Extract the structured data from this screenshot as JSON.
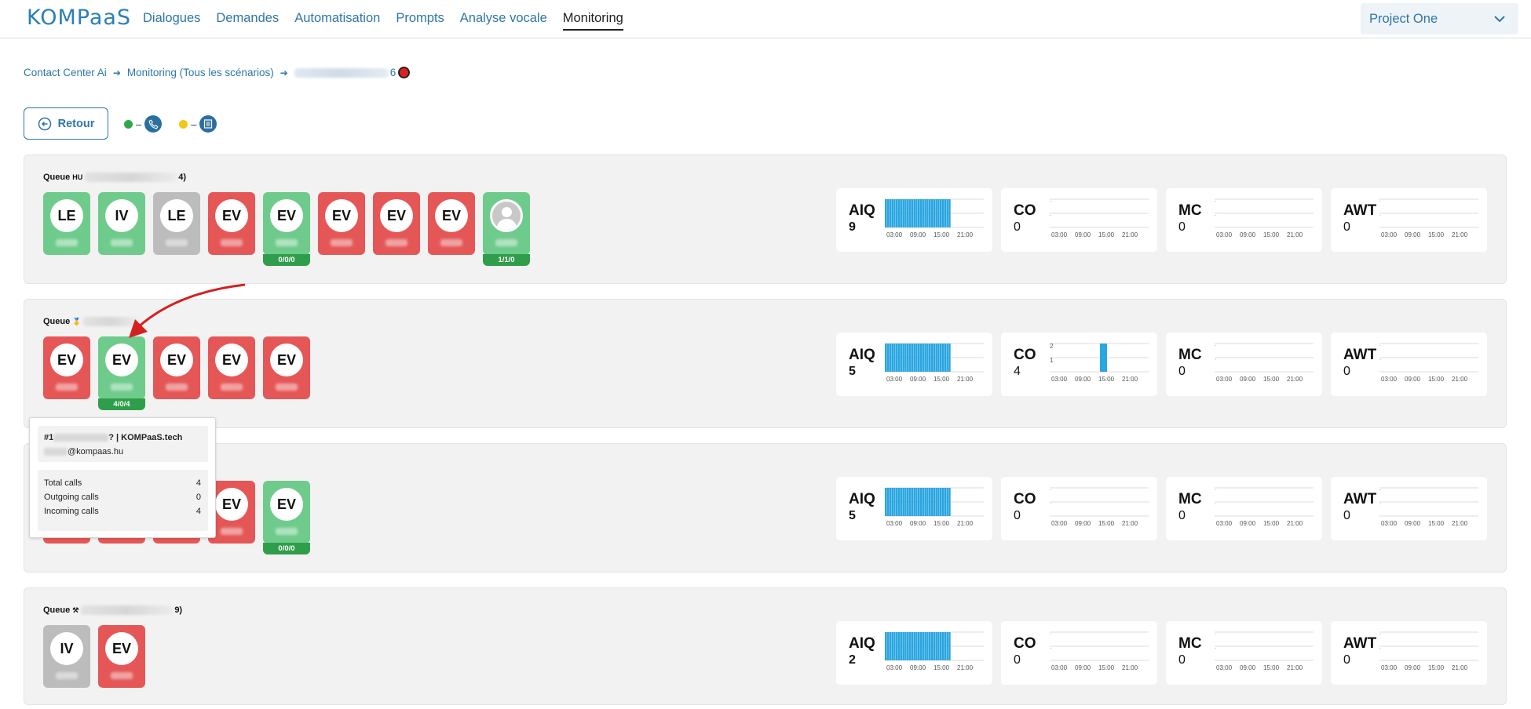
{
  "header": {
    "logo": "KOMPaaS",
    "nav": [
      "Dialogues",
      "Demandes",
      "Automatisation",
      "Prompts",
      "Analyse vocale",
      "Monitoring"
    ],
    "active_nav": "Monitoring",
    "project": "Project One"
  },
  "breadcrumb": {
    "item1": "Contact Center Ai",
    "item2": "Monitoring (Tous les scénarios)",
    "item3_suffix": "6"
  },
  "back_button": "Retour",
  "legend": {
    "green_color": "#2ea84a",
    "yellow_color": "#f5c518",
    "dash": "–"
  },
  "chart_ticks": [
    "03:00",
    "09:00",
    "15:00",
    "21:00"
  ],
  "queues": [
    {
      "title_prefix": "Queue",
      "title_tag": "HU",
      "title_suffix": "4)",
      "agents": [
        {
          "initials": "LE",
          "status": "green"
        },
        {
          "initials": "IV",
          "status": "green"
        },
        {
          "initials": "LE",
          "status": "grey"
        },
        {
          "initials": "EV",
          "status": "red"
        },
        {
          "initials": "EV",
          "status": "green",
          "counts": "0/0/0"
        },
        {
          "initials": "EV",
          "status": "red"
        },
        {
          "initials": "EV",
          "status": "red"
        },
        {
          "initials": "EV",
          "status": "red"
        },
        {
          "initials": "",
          "status": "green",
          "counts": "1/1/0",
          "photo": true
        }
      ],
      "metrics": [
        {
          "label": "AIQ",
          "value": "9",
          "bold": true
        },
        {
          "label": "CO",
          "value": "0",
          "bold": false
        },
        {
          "label": "MC",
          "value": "0",
          "bold": false
        },
        {
          "label": "AWT",
          "value": "0",
          "bold": false
        }
      ]
    },
    {
      "title_prefix": "Queue",
      "title_tag": "🥇",
      "title_suffix": "",
      "agents": [
        {
          "initials": "EV",
          "status": "red"
        },
        {
          "initials": "EV",
          "status": "green",
          "counts": "4/0/4"
        },
        {
          "initials": "EV",
          "status": "red"
        },
        {
          "initials": "EV",
          "status": "red"
        },
        {
          "initials": "EV",
          "status": "red"
        }
      ],
      "metrics": [
        {
          "label": "AIQ",
          "value": "5",
          "bold": true
        },
        {
          "label": "CO",
          "value": "4",
          "bold": false,
          "axis": [
            "2",
            "1"
          ]
        },
        {
          "label": "MC",
          "value": "0",
          "bold": false
        },
        {
          "label": "AWT",
          "value": "0",
          "bold": false
        }
      ]
    },
    {
      "title_prefix": "",
      "title_tag": "",
      "title_suffix": "",
      "agents": [
        {
          "initials": "EV",
          "status": "red"
        },
        {
          "initials": "EV",
          "status": "red"
        },
        {
          "initials": "EV",
          "status": "red"
        },
        {
          "initials": "EV",
          "status": "red"
        },
        {
          "initials": "EV",
          "status": "green",
          "counts": "0/0/0"
        }
      ],
      "metrics": [
        {
          "label": "AIQ",
          "value": "5",
          "bold": true
        },
        {
          "label": "CO",
          "value": "0",
          "bold": false
        },
        {
          "label": "MC",
          "value": "0",
          "bold": false
        },
        {
          "label": "AWT",
          "value": "0",
          "bold": false
        }
      ]
    },
    {
      "title_prefix": "Queue",
      "title_tag": "⚒",
      "title_suffix": "9)",
      "agents": [
        {
          "initials": "IV",
          "status": "grey"
        },
        {
          "initials": "EV",
          "status": "red"
        }
      ],
      "metrics": [
        {
          "label": "AIQ",
          "value": "2",
          "bold": true
        },
        {
          "label": "CO",
          "value": "0",
          "bold": false
        },
        {
          "label": "MC",
          "value": "0",
          "bold": false
        },
        {
          "label": "AWT",
          "value": "0",
          "bold": false
        }
      ]
    }
  ],
  "tooltip": {
    "line1_prefix": "#1",
    "line1_suffix": "? | KOMPaaS.tech",
    "email_suffix": "@kompaas.hu",
    "rows": [
      {
        "label": "Total calls",
        "value": "4"
      },
      {
        "label": "Outgoing calls",
        "value": "0"
      },
      {
        "label": "Incoming calls",
        "value": "4"
      }
    ]
  }
}
